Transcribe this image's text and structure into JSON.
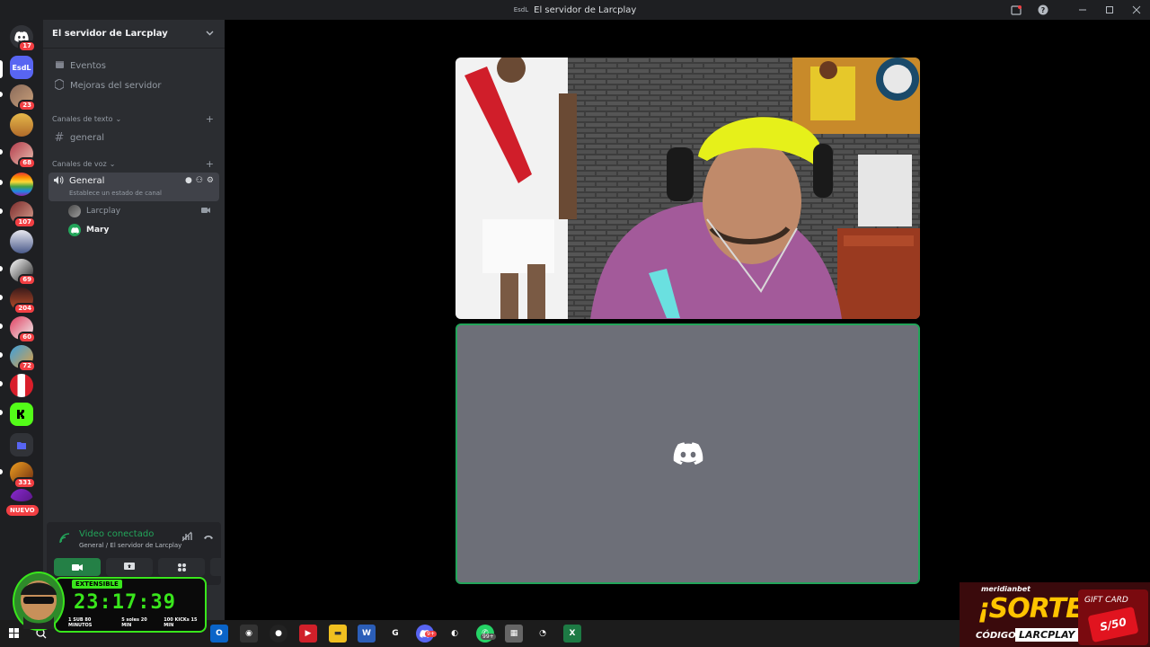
{
  "window": {
    "logo_text": "EsdL",
    "title": "El servidor de Larcplay"
  },
  "rail": {
    "badges": [
      "17",
      "23",
      "68",
      "107",
      "69",
      "204",
      "60",
      "72",
      "331"
    ],
    "nuevo_label": "NUEVO",
    "server_initials": "EsdL"
  },
  "sidebar": {
    "server_name": "El servidor de Larcplay",
    "items": [
      {
        "label": "Eventos"
      },
      {
        "label": "Mejoras del servidor"
      }
    ],
    "text_category": "Canales de texto",
    "text_channel": "general",
    "voice_category": "Canales de voz",
    "voice_channel": {
      "name": "General",
      "status": "Establece un estado de canal"
    },
    "voice_users": [
      "Larcplay",
      "Mary"
    ]
  },
  "voice_panel": {
    "status": "Video conectado",
    "location": "General / El servidor de Larcplay"
  },
  "overlay": {
    "tag": "EXTENSIBLE",
    "time": "23:17:39",
    "rate1": "1 SUB 80 MINUTOS",
    "rate2": "5 soles 20 MIN",
    "rate3": "100 KICKs 15 MIN"
  },
  "ad": {
    "brand": "meridianbet",
    "title": "¡SORTEO!",
    "code_label": "CÓDIGO:",
    "code": "LARCPLAY",
    "gift_label": "GIFT CARD",
    "gift_value": "S/50"
  },
  "taskbar": {
    "discord_badge": "9+",
    "whatsapp_badge": "99+"
  },
  "colors": {
    "accent_green": "#23a55a",
    "overlay_green": "#39e61c",
    "avatar_tile_bg": "#6d6f78",
    "badge_red": "#f23f43",
    "ad_yellow": "#ffc400"
  }
}
